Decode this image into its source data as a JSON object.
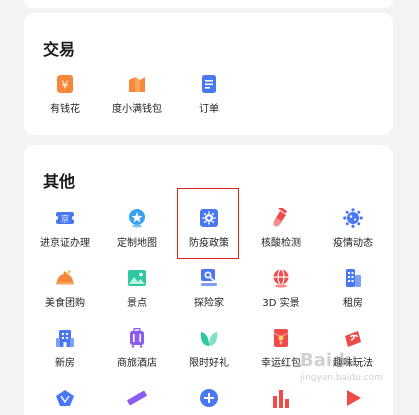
{
  "sections": {
    "trade": {
      "title": "交易",
      "items": [
        {
          "label": "有钱花",
          "icon": "money-icon"
        },
        {
          "label": "度小满钱包",
          "icon": "wallet-icon"
        },
        {
          "label": "订单",
          "icon": "order-icon"
        }
      ]
    },
    "other": {
      "title": "其他",
      "items": [
        {
          "label": "进京证办理",
          "icon": "beijing-pass-icon"
        },
        {
          "label": "定制地图",
          "icon": "custom-map-icon"
        },
        {
          "label": "防疫政策",
          "icon": "epidemic-policy-icon"
        },
        {
          "label": "核酸检测",
          "icon": "test-tube-icon"
        },
        {
          "label": "疫情动态",
          "icon": "virus-icon"
        },
        {
          "label": "美食团购",
          "icon": "food-deal-icon"
        },
        {
          "label": "景点",
          "icon": "scenic-spot-icon"
        },
        {
          "label": "探险家",
          "icon": "explorer-icon"
        },
        {
          "label": "3D 实景",
          "icon": "3d-globe-icon"
        },
        {
          "label": "租房",
          "icon": "rent-house-icon"
        },
        {
          "label": "新房",
          "icon": "new-house-icon"
        },
        {
          "label": "商旅酒店",
          "icon": "luggage-icon"
        },
        {
          "label": "限时好礼",
          "icon": "leaf-gift-icon"
        },
        {
          "label": "幸运红包",
          "icon": "red-envelope-icon"
        },
        {
          "label": "趣味玩法",
          "icon": "fun-play-icon"
        }
      ]
    }
  },
  "watermark": {
    "text": "Baidu",
    "sub": "jingyan.baidu.com"
  },
  "colors": {
    "orange": "#f7873a",
    "blue": "#4a78f2",
    "red": "#ef4b4b",
    "green": "#2ec7a0",
    "highlight": "#e02020"
  }
}
